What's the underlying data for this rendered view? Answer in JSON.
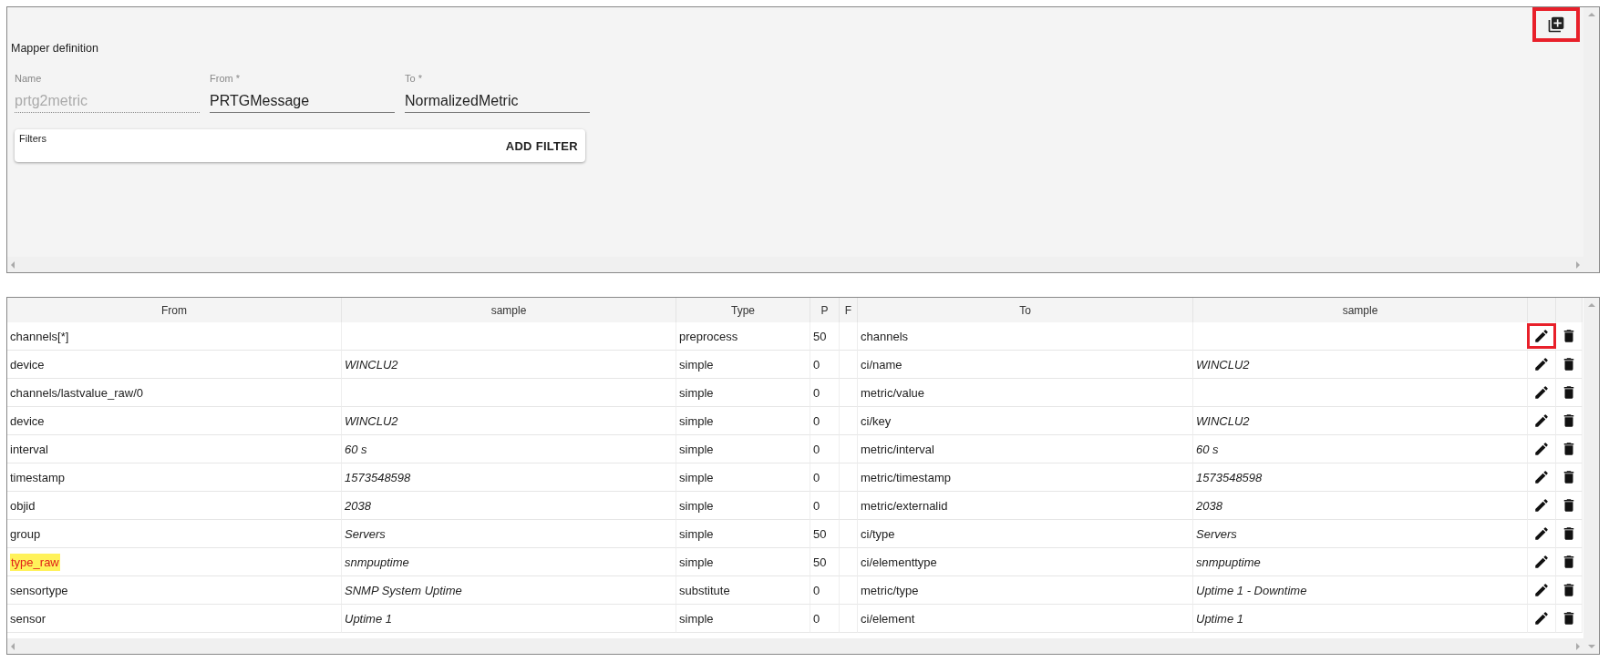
{
  "header_action": {
    "highlighted": true
  },
  "mapper": {
    "title": "Mapper definition",
    "fields": [
      {
        "label": "Name",
        "value": "prtg2metric",
        "disabled": true
      },
      {
        "label": "From *",
        "value": "PRTGMessage",
        "disabled": false
      },
      {
        "label": "To *",
        "value": "NormalizedMetric",
        "disabled": false
      }
    ],
    "filters": {
      "label": "Filters",
      "button": "ADD FILTER"
    }
  },
  "table": {
    "columns": [
      "From",
      "sample",
      "Type",
      "P",
      "F",
      "To",
      "sample"
    ],
    "rows": [
      {
        "from": "channels[*]",
        "from_sample": "",
        "type": "preprocess",
        "p": "50",
        "to": "channels",
        "to_sample": "",
        "from_highlighted": false,
        "edit_highlighted": true
      },
      {
        "from": "device",
        "from_sample": "WINCLU2",
        "type": "simple",
        "p": "0",
        "to": "ci/name",
        "to_sample": "WINCLU2",
        "from_highlighted": false,
        "edit_highlighted": false
      },
      {
        "from": "channels/lastvalue_raw/0",
        "from_sample": "",
        "type": "simple",
        "p": "0",
        "to": "metric/value",
        "to_sample": "",
        "from_highlighted": false,
        "edit_highlighted": false
      },
      {
        "from": "device",
        "from_sample": "WINCLU2",
        "type": "simple",
        "p": "0",
        "to": "ci/key",
        "to_sample": "WINCLU2",
        "from_highlighted": false,
        "edit_highlighted": false
      },
      {
        "from": "interval",
        "from_sample": "60 s",
        "type": "simple",
        "p": "0",
        "to": "metric/interval",
        "to_sample": "60 s",
        "from_highlighted": false,
        "edit_highlighted": false
      },
      {
        "from": "timestamp",
        "from_sample": "1573548598",
        "type": "simple",
        "p": "0",
        "to": "metric/timestamp",
        "to_sample": "1573548598",
        "from_highlighted": false,
        "edit_highlighted": false
      },
      {
        "from": "objid",
        "from_sample": "2038",
        "type": "simple",
        "p": "0",
        "to": "metric/externalid",
        "to_sample": "2038",
        "from_highlighted": false,
        "edit_highlighted": false
      },
      {
        "from": "group",
        "from_sample": "Servers",
        "type": "simple",
        "p": "50",
        "to": "ci/type",
        "to_sample": "Servers",
        "from_highlighted": false,
        "edit_highlighted": false
      },
      {
        "from": "type_raw",
        "from_sample": "snmpuptime",
        "type": "simple",
        "p": "50",
        "to": "ci/elementtype",
        "to_sample": "snmpuptime",
        "from_highlighted": true,
        "edit_highlighted": false
      },
      {
        "from": "sensortype",
        "from_sample": "SNMP System Uptime",
        "type": "substitute",
        "p": "0",
        "to": "metric/type",
        "to_sample": "Uptime 1 - Downtime",
        "from_highlighted": false,
        "edit_highlighted": false
      },
      {
        "from": "sensor",
        "from_sample": "Uptime 1",
        "type": "simple",
        "p": "0",
        "to": "ci/element",
        "to_sample": "Uptime 1",
        "from_highlighted": false,
        "edit_highlighted": false
      }
    ]
  }
}
